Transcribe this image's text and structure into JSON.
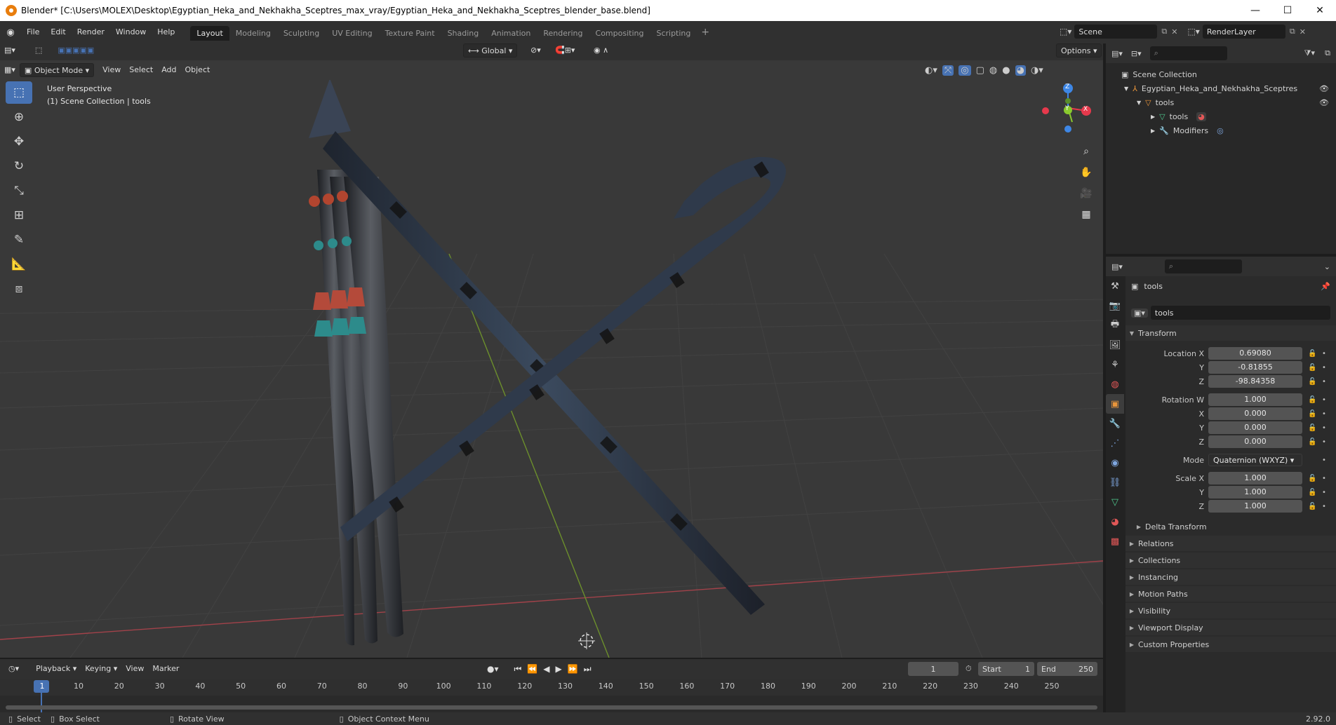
{
  "window": {
    "title": "Blender* [C:\\Users\\MOLEX\\Desktop\\Egyptian_Heka_and_Nekhakha_Sceptres_max_vray/Egyptian_Heka_and_Nekhakha_Sceptres_blender_base.blend]",
    "minimize": "—",
    "maximize": "☐",
    "close": "✕"
  },
  "menu": {
    "file": "File",
    "edit": "Edit",
    "render": "Render",
    "window": "Window",
    "help": "Help"
  },
  "workspaces": [
    {
      "label": "Layout",
      "active": true
    },
    {
      "label": "Modeling"
    },
    {
      "label": "Sculpting"
    },
    {
      "label": "UV Editing"
    },
    {
      "label": "Texture Paint"
    },
    {
      "label": "Shading"
    },
    {
      "label": "Animation"
    },
    {
      "label": "Rendering"
    },
    {
      "label": "Compositing"
    },
    {
      "label": "Scripting"
    }
  ],
  "add_workspace": "+",
  "scene": {
    "label": "Scene",
    "layer": "RenderLayer"
  },
  "viewport": {
    "transform_orientation": "Global",
    "options": "Options",
    "mode": "Object Mode",
    "view": "View",
    "select": "Select",
    "add": "Add",
    "object": "Object",
    "perspective": "User Perspective",
    "collection_info": "(1) Scene Collection | tools",
    "gizmo": {
      "x": "X",
      "y": "Y",
      "z": "Z"
    }
  },
  "outliner": {
    "scene_collection": "Scene Collection",
    "items": [
      {
        "label": "Egyptian_Heka_and_Nekhakha_Sceptres",
        "indent": 1
      },
      {
        "label": "tools",
        "indent": 2
      },
      {
        "label": "tools",
        "indent": 3
      },
      {
        "label": "Modifiers",
        "indent": 3
      }
    ]
  },
  "properties": {
    "object_name": "tools",
    "datablock_name": "tools",
    "transform": {
      "title": "Transform",
      "location_label": "Location X",
      "location": {
        "x": "0.69080",
        "y": "-0.81855",
        "z": "-98.84358"
      },
      "rotation_label": "Rotation W",
      "rotation": {
        "w": "1.000",
        "x": "0.000",
        "y": "0.000",
        "z": "0.000"
      },
      "mode_label": "Mode",
      "mode": "Quaternion (WXYZ)",
      "scale_label": "Scale X",
      "scale": {
        "x": "1.000",
        "y": "1.000",
        "z": "1.000"
      },
      "y": "Y",
      "z": "Z",
      "x": "X"
    },
    "sections": [
      "Delta Transform",
      "Relations",
      "Collections",
      "Instancing",
      "Motion Paths",
      "Visibility",
      "Viewport Display",
      "Custom Properties"
    ]
  },
  "timeline": {
    "playback": "Playback",
    "keying": "Keying",
    "view": "View",
    "marker": "Marker",
    "current_frame": "1",
    "start_label": "Start",
    "start": "1",
    "end_label": "End",
    "end": "250",
    "ruler": [
      "1",
      "10",
      "20",
      "30",
      "40",
      "50",
      "60",
      "70",
      "80",
      "90",
      "100",
      "110",
      "120",
      "130",
      "140",
      "150",
      "160",
      "170",
      "180",
      "190",
      "200",
      "210",
      "220",
      "230",
      "240",
      "250"
    ]
  },
  "status": {
    "select": "Select",
    "box_select": "Box Select",
    "rotate_view": "Rotate View",
    "context_menu": "Object Context Menu",
    "version": "2.92.0"
  },
  "colors": {
    "accent": "#4772b3",
    "x_axis": "#e6394c",
    "y_axis": "#8acb2e",
    "z_axis": "#3e87e6",
    "object": "#e87d0d"
  }
}
